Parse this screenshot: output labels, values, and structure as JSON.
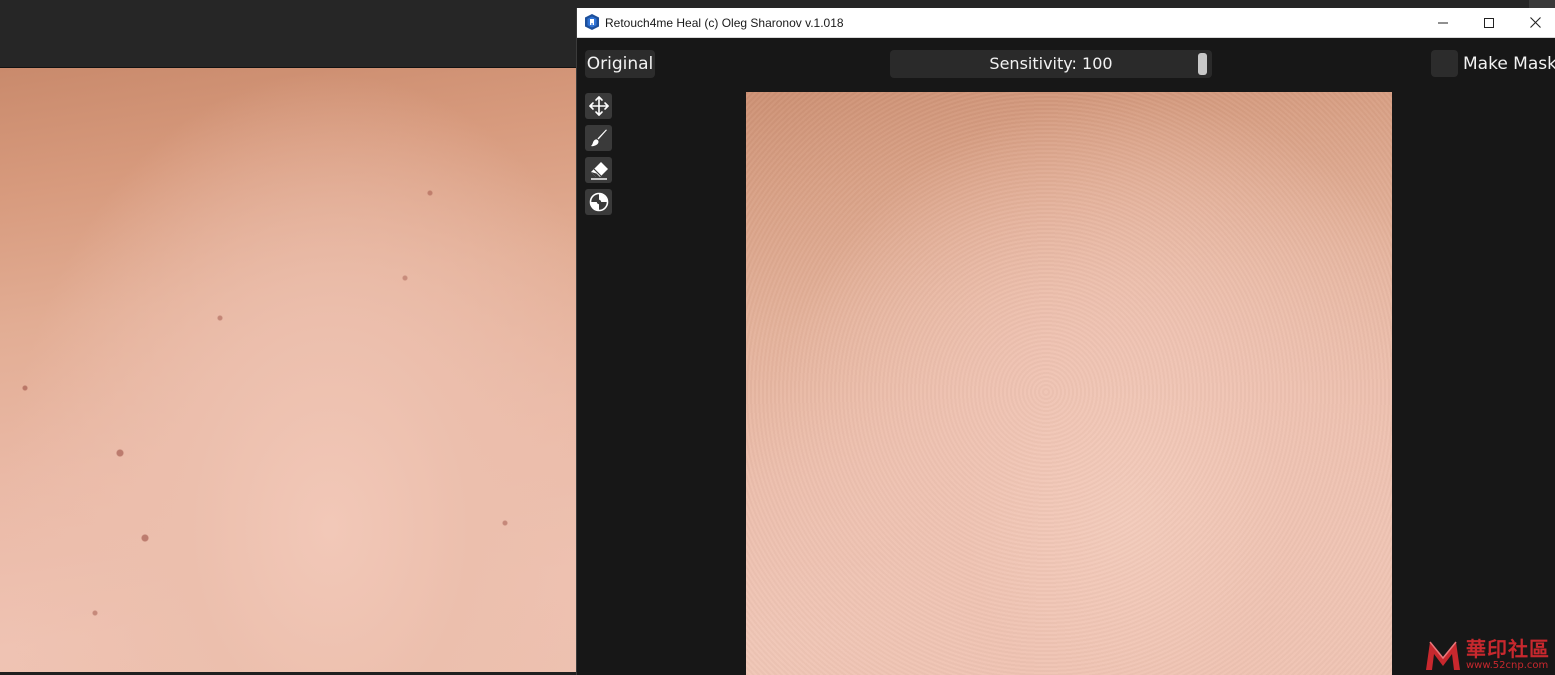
{
  "window": {
    "title": "Retouch4me Heal (c) Oleg Sharonov v.1.018"
  },
  "toolbar": {
    "original_label": "Original",
    "sensitivity_label": "Sensitivity:",
    "sensitivity_value": 100,
    "sensitivity_max": 100,
    "sensitivity_display": "Sensitivity: 100",
    "make_mask_label": "Make Mask",
    "make_mask_checked": false
  },
  "tools": [
    {
      "name": "move",
      "icon": "move-icon"
    },
    {
      "name": "brush",
      "icon": "brush-icon"
    },
    {
      "name": "eraser",
      "icon": "eraser-icon"
    },
    {
      "name": "pipette",
      "icon": "target-icon"
    }
  ],
  "watermark": {
    "chinese": "華印社區",
    "domain": "www.52cnp.com"
  },
  "colors": {
    "accent_logo": "#c8282e",
    "window_bg": "#171717",
    "control_bg": "#2c2c2c"
  }
}
